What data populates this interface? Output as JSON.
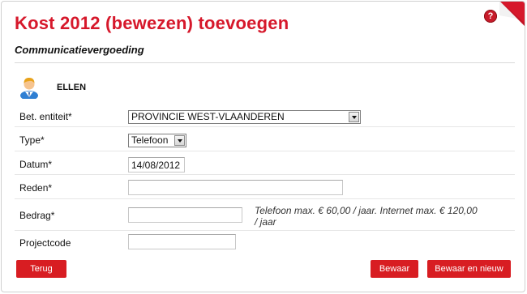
{
  "header": {
    "title": "Kost 2012 (bewezen) toevoegen",
    "subtitle": "Communicatievergoeding",
    "help_glyph": "?"
  },
  "user": {
    "name": "ELLEN",
    "icon": "user-avatar-icon"
  },
  "form": {
    "entity": {
      "label": "Bet. entiteit*",
      "value": "PROVINCIE WEST-VLAANDEREN"
    },
    "type": {
      "label": "Type*",
      "value": "Telefoon"
    },
    "date": {
      "label": "Datum*",
      "value": "14/08/2012"
    },
    "reason": {
      "label": "Reden*",
      "value": ""
    },
    "amount": {
      "label": "Bedrag*",
      "value": "",
      "hint": "Telefoon max. € 60,00 / jaar. Internet max. € 120,00 / jaar"
    },
    "project_code": {
      "label": "Projectcode",
      "value": ""
    }
  },
  "buttons": {
    "back": "Terug",
    "save": "Bewaar",
    "save_new": "Bewaar en nieuw"
  },
  "colors": {
    "accent": "#d6182b",
    "button": "#d81d22"
  }
}
